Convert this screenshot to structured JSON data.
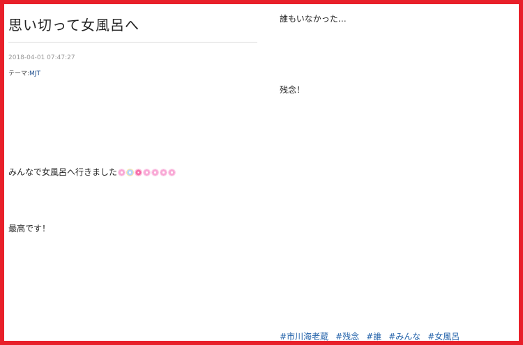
{
  "post": {
    "title": "思い切って女風呂へ",
    "date": "2018-04-01 07:47:27",
    "theme_label": "テーマ:",
    "theme_value": "MJT",
    "line1": "みんなで女風呂へ行きました",
    "line2": "最高です！"
  },
  "right": {
    "line1": "誰もいなかった…",
    "line2": "残念！"
  },
  "tags": [
    "#市川海老蔵",
    "#残念",
    "#誰",
    "#みんな",
    "#女風呂"
  ],
  "colors": {
    "frame": "#e8202a",
    "link": "#1f5fa8",
    "emoji_pink": "#f9a9d6"
  }
}
